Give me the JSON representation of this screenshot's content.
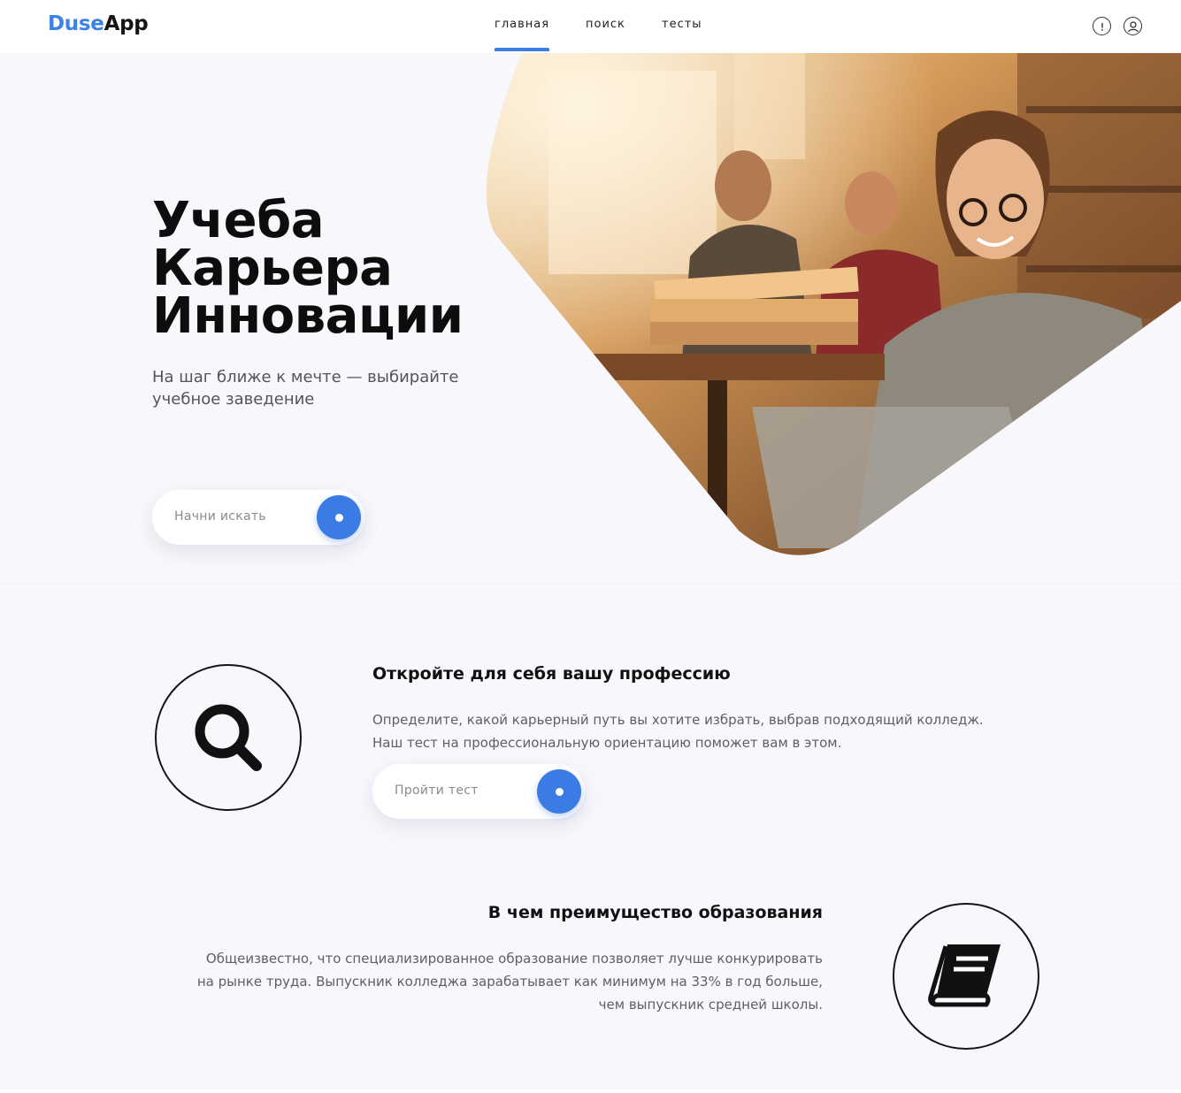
{
  "brand": {
    "part1": "Duse",
    "part2": "App",
    "accent": "#3b82e8"
  },
  "nav": {
    "items": [
      {
        "label": "главная",
        "active": true
      },
      {
        "label": "поиск",
        "active": false
      },
      {
        "label": "тесты",
        "active": false
      }
    ],
    "icons": [
      "info-icon",
      "user-icon"
    ]
  },
  "hero": {
    "title_lines": [
      "Учеба",
      "Карьера",
      "Инновации"
    ],
    "subtitle": "На шаг ближе к мечте — выбирайте учебное заведение",
    "search_button_label": "Начни искать"
  },
  "profession": {
    "icon": "search-icon",
    "title": "Откройте для себя вашу профессию",
    "text_line1": "Определите, какой карьерный путь вы хотите избрать, выбрав подходящий колледж.",
    "text_line2": "Наш тест на профессиональную ориентацию поможет вам в этом.",
    "button_label": "Пройти тест"
  },
  "advantage": {
    "icon": "book-icon",
    "title": "В чем преимущество образования",
    "text_line1": "Общеизвестно, что специализированное образование позволяет лучше конкурировать",
    "text_line2": "на рынке труда. Выпускник колледжа зарабатывает как минимум на 33% в год больше,",
    "text_line3": "чем выпускник средней школы."
  },
  "colors": {
    "primary": "#3a7ce4",
    "background": "#f8f7fc",
    "text": "#111111"
  }
}
